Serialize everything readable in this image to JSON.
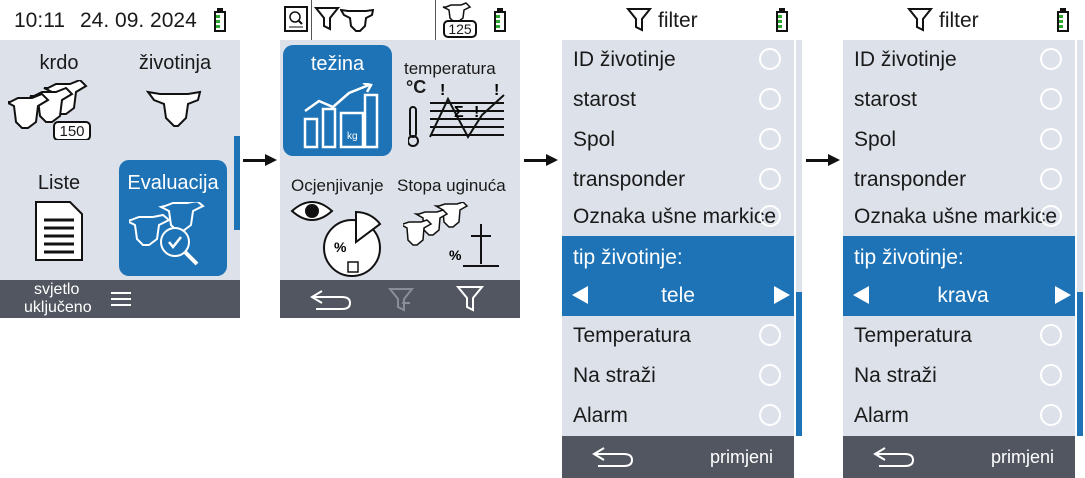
{
  "screen1": {
    "time": "10:11",
    "date": "24. 09. 2024",
    "tiles": {
      "herd": "krdo",
      "herd_count": "150",
      "animal": "životinja",
      "lists": "Liste",
      "evaluation": "Evaluacija"
    },
    "bottom": {
      "light_line1": "svjetlo",
      "light_line2": "uključeno",
      "menu_icon": "hamburger-menu-icon"
    }
  },
  "screen2": {
    "header_count": "125",
    "tiles": {
      "weight": "težina",
      "temperature": "temperatura",
      "temp_unit": "°C",
      "rating": "Ocjenjivanje",
      "mortality": "Stopa uginuća"
    }
  },
  "screen3": {
    "title": "filter",
    "items": [
      "ID životinje",
      "starost",
      "Spol",
      "transponder",
      "Oznaka ušne markice"
    ],
    "type_label": "tip životinje:",
    "type_value": "tele",
    "items_after": [
      "Temperatura",
      "Na straži",
      "Alarm"
    ],
    "apply": "primjeni"
  },
  "screen4": {
    "title": "filter",
    "items": [
      "ID životinje",
      "starost",
      "Spol",
      "transponder",
      "Oznaka ušne markice"
    ],
    "type_label": "tip životinje:",
    "type_value": "krava",
    "items_after": [
      "Temperatura",
      "Na straži",
      "Alarm"
    ],
    "apply": "primjeni"
  },
  "colors": {
    "accent": "#1e73b6",
    "panel": "#dde2ea",
    "bar": "#525660",
    "battery": "#2ea82e"
  }
}
